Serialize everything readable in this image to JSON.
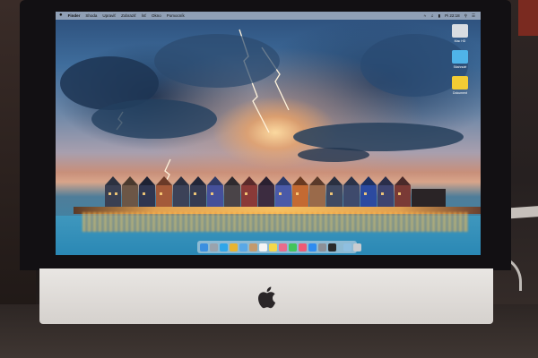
{
  "menubar": {
    "apple": "",
    "items": [
      "Finder",
      "Shoda",
      "Upraviť",
      "Zobraziť",
      "Ísť",
      "Okno",
      "Pomocník"
    ],
    "clock": "Pi 22:18",
    "status_icons": [
      "wifi-icon",
      "volume-icon",
      "battery-icon",
      "search-icon",
      "notification-icon"
    ]
  },
  "desktop_icons": [
    {
      "label": "Mac HD",
      "icon": "hard-drive-icon",
      "color": "#d9dde2"
    },
    {
      "label": "Stiahnuté",
      "icon": "folder-icon",
      "color": "#4fb3e8"
    },
    {
      "label": "Dokument",
      "icon": "document-icon",
      "color": "#f2cc34"
    }
  ],
  "dock": {
    "apps": [
      {
        "name": "finder-icon",
        "color": "#3b8fe0"
      },
      {
        "name": "launchpad-icon",
        "color": "#9aa3ad"
      },
      {
        "name": "safari-icon",
        "color": "#2fa6e9"
      },
      {
        "name": "chrome-icon",
        "color": "#e8b431"
      },
      {
        "name": "mail-icon",
        "color": "#5aa8e6"
      },
      {
        "name": "contacts-icon",
        "color": "#c49a6c"
      },
      {
        "name": "calendar-icon",
        "color": "#f4f4f4"
      },
      {
        "name": "notes-icon",
        "color": "#f5d84a"
      },
      {
        "name": "photos-icon",
        "color": "#e86b8b"
      },
      {
        "name": "messages-icon",
        "color": "#43c45a"
      },
      {
        "name": "music-icon",
        "color": "#ee5a74"
      },
      {
        "name": "app-store-icon",
        "color": "#2f8cf0"
      },
      {
        "name": "system-preferences-icon",
        "color": "#8c9097"
      },
      {
        "name": "terminal-icon",
        "color": "#2a2a2a"
      }
    ],
    "trailing": [
      {
        "name": "downloads-icon",
        "color": "#8fbfe0"
      },
      {
        "name": "trash-icon",
        "color": "#c9ccd0"
      }
    ]
  },
  "colors": {
    "sky_top": "#2c4e7a",
    "sunset": "#d8a58a",
    "water": "#2a88b5",
    "chin": "#e9e6e3"
  }
}
